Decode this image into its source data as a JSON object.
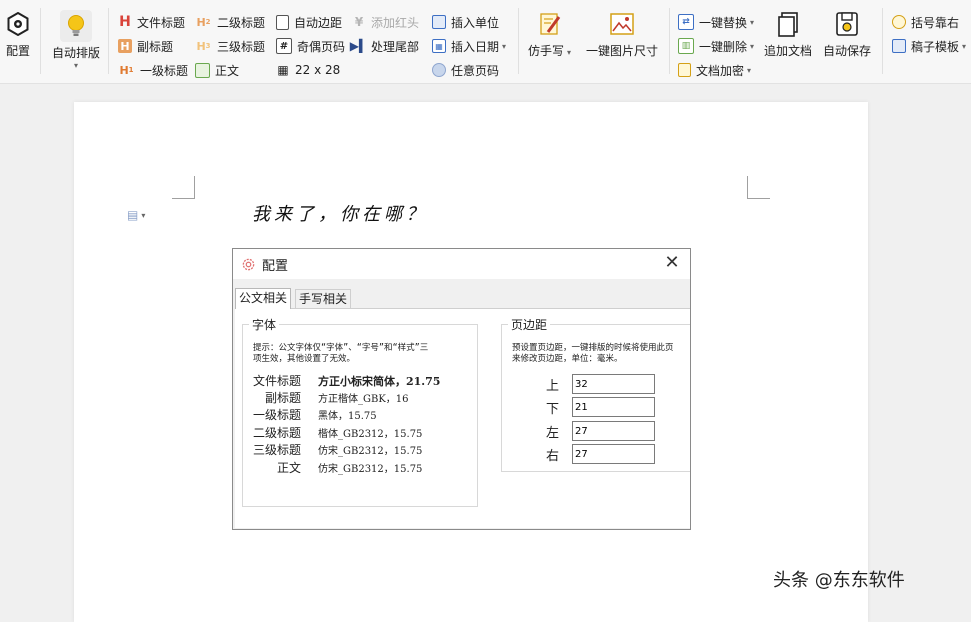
{
  "toolbar": {
    "config": "配置",
    "auto_layout": "自动排版",
    "file_title": "文件标题",
    "subtitle": "副标题",
    "level1": "一级标题",
    "level2": "二级标题",
    "level3": "三级标题",
    "body": "正文",
    "auto_margin": "自动边距",
    "odd_even_page": "奇偶页码",
    "grid_size": "22 x 28",
    "add_red_header": "添加红头",
    "handle_tail": "处理尾部",
    "insert_unit": "插入单位",
    "insert_date": "插入日期",
    "any_page_number": "任意页码",
    "fake_handwriting": "仿手写",
    "image_size": "一键图片尺寸",
    "one_key_replace": "一键替换",
    "one_key_delete": "一键删除",
    "doc_encrypt": "文档加密",
    "append_doc": "追加文档",
    "auto_save": "自动保存",
    "bracket_right": "括号靠右",
    "draft_template": "稿子模板"
  },
  "document": {
    "handwritten_text": "我来了，你在哪？"
  },
  "dialog": {
    "title": "配置",
    "close_glyph": "✕",
    "tabs": [
      "公文相关",
      "手写相关"
    ],
    "font_group": {
      "title": "字体",
      "hint_line1": "提示：公文字体仅“字体”、“字号”和“样式”三",
      "hint_line2": "项生效，其他设置了无效。",
      "rows": [
        {
          "name": "文件标题",
          "value": "方正小标宋简体，21.75"
        },
        {
          "name": "副标题",
          "value": "方正楷体_GBK，16"
        },
        {
          "name": "一级标题",
          "value": "黑体，15.75"
        },
        {
          "name": "二级标题",
          "value": "楷体_GB2312，15.75"
        },
        {
          "name": "三级标题",
          "value": "仿宋_GB2312，15.75"
        },
        {
          "name": "正文",
          "value": "仿宋_GB2312，15.75"
        }
      ]
    },
    "margin_group": {
      "title": "页边距",
      "hint_line1": "预设置页边距，一键排版的时候将使用此页",
      "hint_line2": "来修改页边距，单位：毫米。",
      "rows": [
        {
          "label": "上",
          "value": "32"
        },
        {
          "label": "下",
          "value": "21"
        },
        {
          "label": "左",
          "value": "27"
        },
        {
          "label": "右",
          "value": "27"
        }
      ]
    }
  },
  "watermark": "头条 @东东软件",
  "colors": {
    "heading_red": "#d9433a",
    "heading_orange": "#e8a060",
    "body_green": "#6aa84f",
    "icon_blue": "#3d6fc4",
    "icon_yellow": "#f5c518"
  }
}
